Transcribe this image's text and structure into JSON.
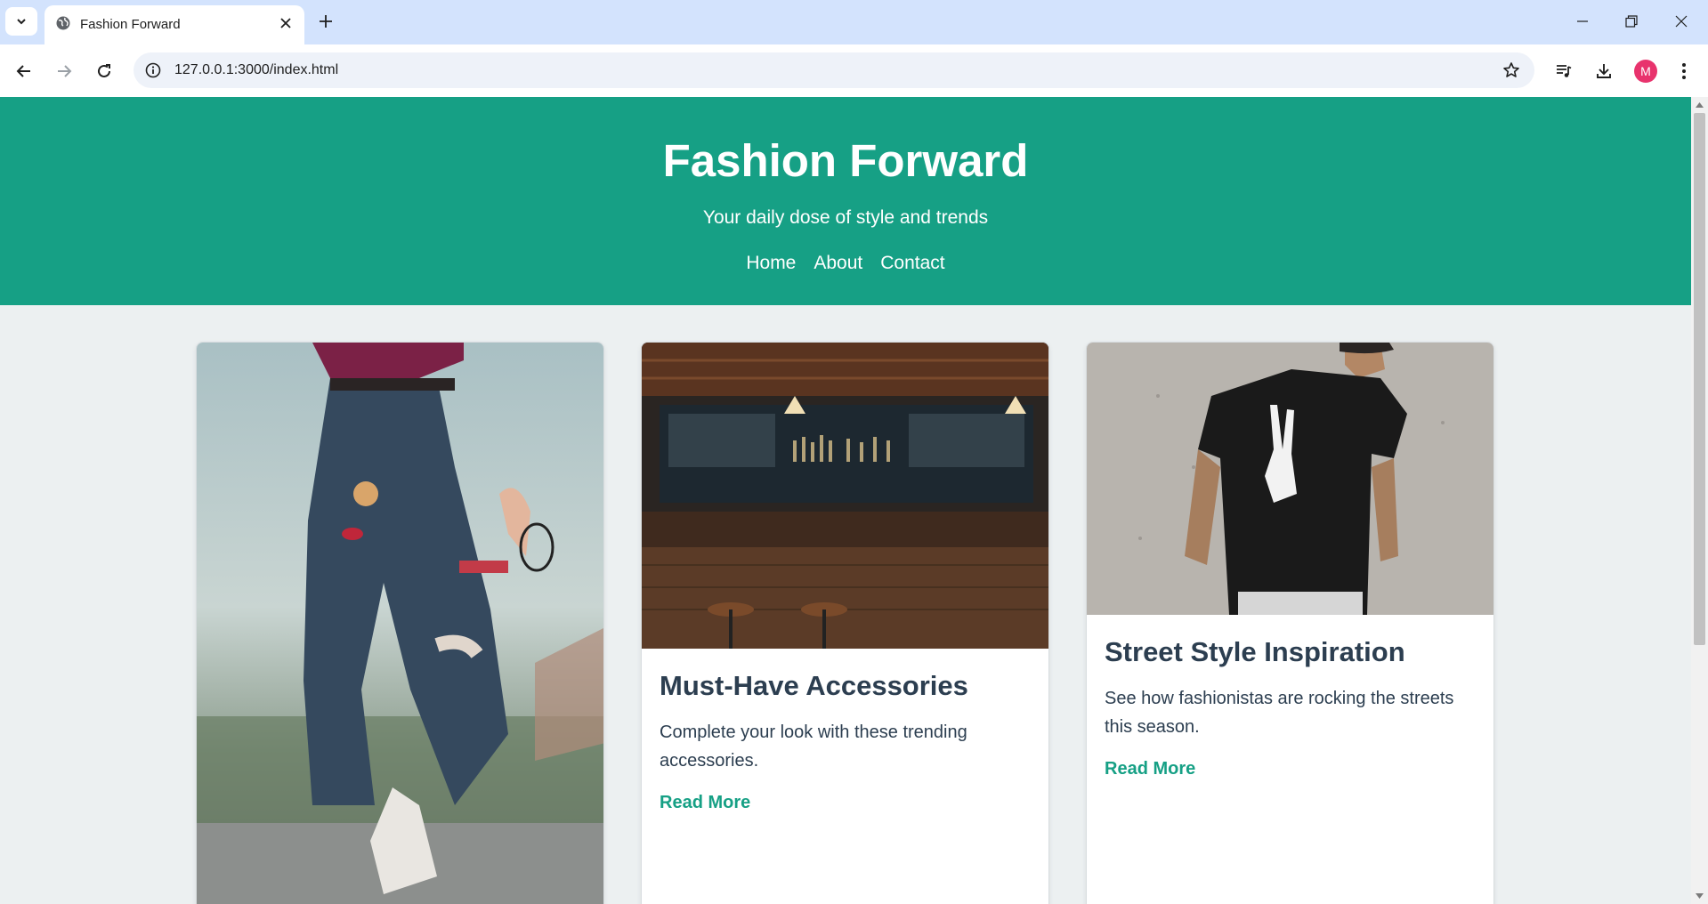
{
  "browser": {
    "tab_title": "Fashion Forward",
    "url": "127.0.0.1:3000/index.html",
    "profile_initial": "M"
  },
  "site": {
    "title": "Fashion Forward",
    "tagline": "Your daily dose of style and trends",
    "nav": [
      "Home",
      "About",
      "Contact"
    ],
    "accent_color": "#16a085",
    "text_color": "#2c3e50"
  },
  "cards": [
    {
      "title": "",
      "text": "",
      "link": ""
    },
    {
      "title": "Must-Have Accessories",
      "text": "Complete your look with these trending accessories.",
      "link": "Read More"
    },
    {
      "title": "Street Style Inspiration",
      "text": "See how fashionistas are rocking the streets this season.",
      "link": "Read More"
    }
  ]
}
